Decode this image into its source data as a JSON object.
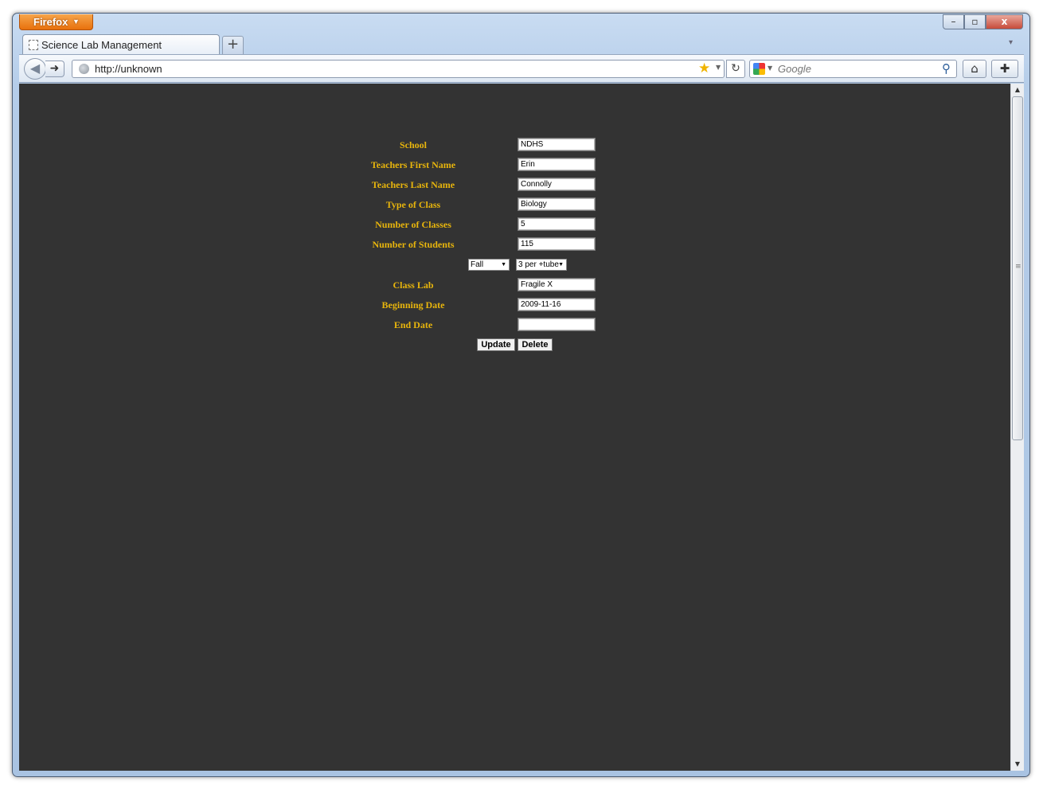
{
  "browser": {
    "app_button": "Firefox",
    "tab_title": "Science Lab Management",
    "url": "http://unknown",
    "search_placeholder": "Google",
    "window_controls": {
      "minimize": "–",
      "maximize": "▫",
      "close": "x"
    }
  },
  "form": {
    "fields": [
      {
        "label": "School",
        "value": "NDHS"
      },
      {
        "label": "Teachers First Name",
        "value": "Erin"
      },
      {
        "label": "Teachers Last Name",
        "value": "Connolly"
      },
      {
        "label": "Type of Class",
        "value": "Biology"
      },
      {
        "label": "Number of Classes",
        "value": "5"
      },
      {
        "label": "Number of Students",
        "value": "115"
      }
    ],
    "selects": {
      "semester": "Fall",
      "ratio": "3 per +tube"
    },
    "fields2": [
      {
        "label": "Class Lab",
        "value": "Fragile X"
      },
      {
        "label": "Beginning Date",
        "value": "2009-11-16"
      },
      {
        "label": "End Date",
        "value": ""
      }
    ],
    "buttons": {
      "update": "Update",
      "delete": "Delete"
    }
  },
  "colors": {
    "page_bg": "#333333",
    "label_color": "#e8b50c"
  }
}
